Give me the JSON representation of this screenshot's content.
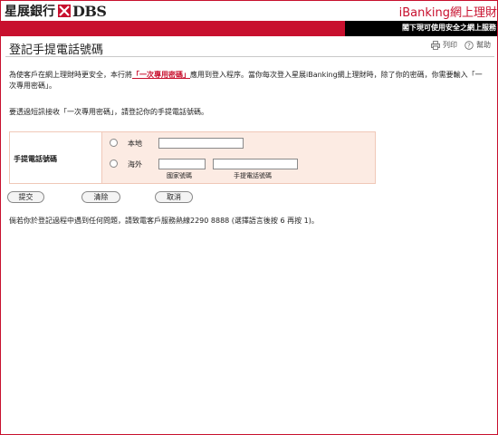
{
  "header": {
    "logo_cn": "星展銀行",
    "logo_en": "DBS",
    "brand": "iBanking網上理財",
    "warning": "閣下現可使用安全之網上服務"
  },
  "page": {
    "title": "登記手提電話號碼",
    "print_label": "列印",
    "help_label": "幫助"
  },
  "intro": {
    "part1": "為使客戶在網上理財時更安全，本行將",
    "link": "「一次專用密碼」",
    "part2": "應用到登入程序。當你每次登入星展iBanking網上理財時，除了你的密碼，你需要輸入「一次專用密碼」。"
  },
  "instruction": "要透過短訊接收「一次專用密碼」，請登記你的手提電話號碼。",
  "form": {
    "field_label": "手提電話號碼",
    "local_label": "本地",
    "overseas_label": "海外",
    "country_code_label": "國家號碼",
    "mobile_number_label": "手提電話號碼",
    "local_value": "",
    "country_code_value": "",
    "overseas_mobile_value": ""
  },
  "buttons": {
    "submit": "提交",
    "clear": "清除",
    "cancel": "取消"
  },
  "hotline": "倘若你於登記過程中遇到任何問題，請致電客戶服務熱線2290 8888 (選擇語言後按 6 再按 1)。",
  "colors": {
    "brand_red": "#c8102e",
    "form_bg": "#fcebe3"
  }
}
